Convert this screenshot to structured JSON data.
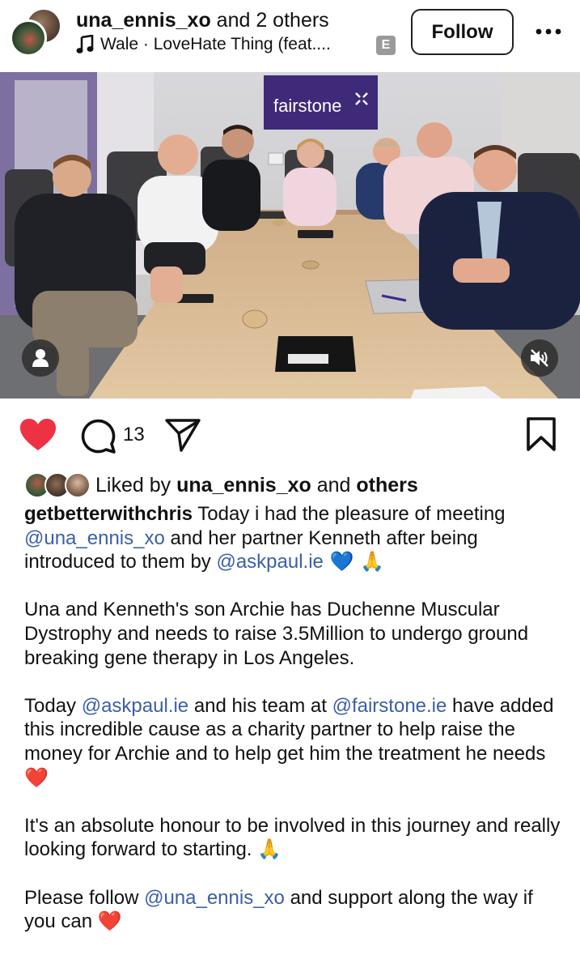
{
  "header": {
    "username": "una_ennis_xo",
    "coauthors": " and 2 others",
    "music": "Wale · LoveHate Thing (feat....",
    "explicit_badge": "E",
    "follow_label": "Follow",
    "more_icon": "more-horizontal-icon"
  },
  "photo": {
    "sign_text": "fairstone",
    "tag_icon": "person-icon",
    "mute_icon": "speaker-muted-icon"
  },
  "actions": {
    "like_icon": "heart-filled-icon",
    "like_color": "#ed3244",
    "comment_icon": "comment-bubble-icon",
    "comment_count": "13",
    "share_icon": "paper-plane-icon",
    "save_icon": "bookmark-icon"
  },
  "liked_by": {
    "prefix": "Liked by ",
    "user": "una_ennis_xo",
    "middle": " and ",
    "others": "others"
  },
  "caption": {
    "author": "getbetterwithchris",
    "p1": {
      "t1": " Today i had the pleasure of meeting ",
      "m1": "@una_ennis_xo",
      "t2": " and her partner Kenneth after being introduced to them by ",
      "m2": "@askpaul.ie",
      "e1": " 💙",
      "e2": " 🙏"
    },
    "p2": "Una and Kenneth's son Archie has Duchenne Muscular Dystrophy and needs to raise 3.5Million to undergo ground breaking gene therapy in Los Angeles.",
    "p3": {
      "t1": "Today ",
      "m1": "@askpaul.ie",
      "t2": " and his team at ",
      "m2": "@fairstone.ie",
      "t3": " have added this incredible cause as a charity partner  to help raise the money for Archie and to help get him the treatment he needs ",
      "e1": "❤️"
    },
    "p4": {
      "t1": "It's an absolute honour to be involved in this journey and really looking forward to starting. ",
      "e1": "🙏"
    },
    "p5": {
      "t1": "Please follow ",
      "m1": "@una_ennis_xo",
      "t2": " and support along the way if you can ",
      "e1": "❤️"
    }
  },
  "colors": {
    "mention": "#3a5fa8",
    "sign_purple": "#3f2a7a",
    "like_red": "#ed3244"
  }
}
